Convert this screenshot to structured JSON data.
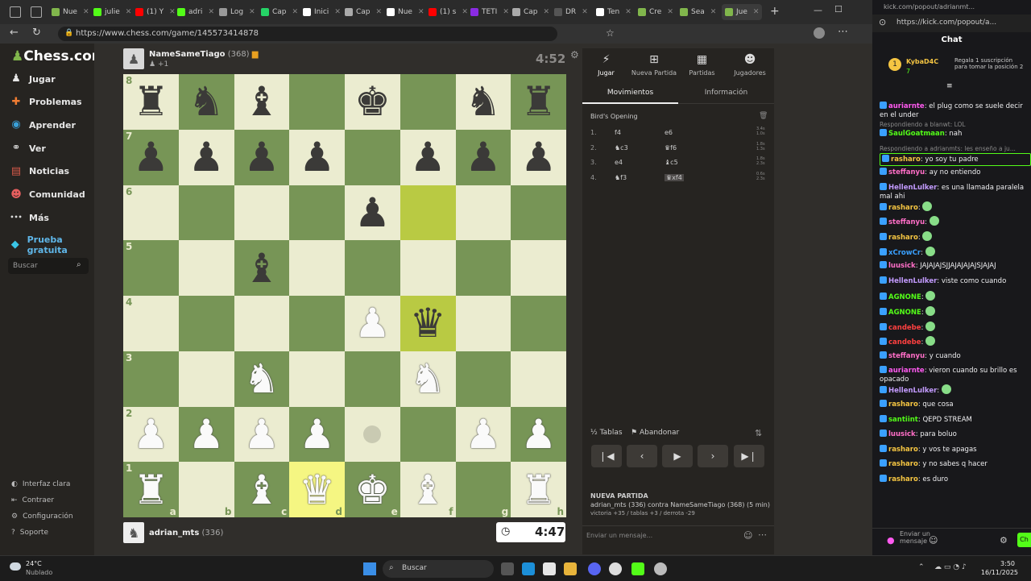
{
  "browser": {
    "tabs": [
      {
        "label": "Nue",
        "color": "#81b64c"
      },
      {
        "label": "julie",
        "color": "#53fc18"
      },
      {
        "label": "(1) Y",
        "color": "#ff0000"
      },
      {
        "label": "adri",
        "color": "#53fc18"
      },
      {
        "label": "Log",
        "color": "#999999"
      },
      {
        "label": "Cap",
        "color": "#25d366"
      },
      {
        "label": "Inici",
        "color": "#ffffff"
      },
      {
        "label": "Cap",
        "color": "#aaaaaa"
      },
      {
        "label": "Nue",
        "color": "#ffffff"
      },
      {
        "label": "(1) s",
        "color": "#ff0000"
      },
      {
        "label": "TETI",
        "color": "#8a2be2"
      },
      {
        "label": "Cap",
        "color": "#aaaaaa"
      },
      {
        "label": "DR",
        "color": "#555555"
      },
      {
        "label": "Ten",
        "color": "#ffffff"
      },
      {
        "label": "Cre",
        "color": "#81b64c"
      },
      {
        "label": "Sea",
        "color": "#81b64c"
      },
      {
        "label": "Jue",
        "color": "#81b64c"
      }
    ],
    "url": "https://www.chess.com/game/145573414878"
  },
  "sidebar": {
    "logo": "Chess.com",
    "items": [
      {
        "label": "Jugar",
        "icon": "pawn-icon"
      },
      {
        "label": "Problemas",
        "icon": "puzzle-icon"
      },
      {
        "label": "Aprender",
        "icon": "learn-icon"
      },
      {
        "label": "Ver",
        "icon": "binoculars-icon"
      },
      {
        "label": "Noticias",
        "icon": "news-icon"
      },
      {
        "label": "Comunidad",
        "icon": "community-icon"
      },
      {
        "label": "Más",
        "icon": "more-icon"
      },
      {
        "label": "Prueba gratuita",
        "icon": "diamond-icon"
      }
    ],
    "search_placeholder": "Buscar",
    "bottom": [
      "Interfaz clara",
      "Contraer",
      "Configuración",
      "Soporte"
    ]
  },
  "game": {
    "top_player": {
      "name": "NameSameTiago",
      "rating": "(368)",
      "sub": "+1",
      "clock": "4:52"
    },
    "bottom_player": {
      "name": "adrian_mts",
      "rating": "(336)",
      "clock": "4:47"
    },
    "files": [
      "a",
      "b",
      "c",
      "d",
      "e",
      "f",
      "g",
      "h"
    ],
    "ranks": [
      "8",
      "7",
      "6",
      "5",
      "4",
      "3",
      "2",
      "1"
    ],
    "board": [
      [
        "br",
        "bn",
        "bb",
        "",
        "bk",
        "",
        "bn",
        "br"
      ],
      [
        "bp",
        "bp",
        "bp",
        "bp",
        "",
        "bp",
        "bp",
        "bp"
      ],
      [
        "",
        "",
        "",
        "",
        "bp",
        "",
        "",
        ""
      ],
      [
        "",
        "",
        "bb",
        "",
        "",
        "",
        "",
        ""
      ],
      [
        "",
        "",
        "",
        "",
        "wp",
        "bq",
        "",
        ""
      ],
      [
        "",
        "",
        "wn",
        "",
        "",
        "wn",
        "",
        ""
      ],
      [
        "wp",
        "wp",
        "wp",
        "wp",
        "",
        "",
        "wp",
        "wp"
      ],
      [
        "wr",
        "",
        "wb",
        "wq",
        "wk",
        "wb",
        "",
        "wr"
      ]
    ]
  },
  "panel": {
    "tabs": [
      {
        "label": "Jugar",
        "icon": "lightning-icon"
      },
      {
        "label": "Nueva Partida",
        "icon": "plus-icon"
      },
      {
        "label": "Partidas",
        "icon": "grid-icon"
      },
      {
        "label": "Jugadores",
        "icon": "players-icon"
      }
    ],
    "subtabs": [
      "Movimientos",
      "Información"
    ],
    "opening": "Bird's Opening",
    "moves": [
      {
        "n": "1.",
        "w": "f4",
        "b": "e6",
        "t": [
          "3.4s",
          "1.0s"
        ]
      },
      {
        "n": "2.",
        "w": "♞c3",
        "b": "♛f6",
        "t": [
          "1.8s",
          "1.3s"
        ]
      },
      {
        "n": "3.",
        "w": "e4",
        "b": "♝c5",
        "t": [
          "1.8s",
          "2.3s"
        ]
      },
      {
        "n": "4.",
        "w": "♞f3",
        "b": "♛xf4",
        "t": [
          "0.6s",
          "2.3s"
        ]
      }
    ],
    "controls": [
      "⏮",
      "◀",
      "▶",
      "▶",
      "⏭"
    ],
    "draw": "Tablas",
    "resign": "Abandonar",
    "new_game_title": "NUEVA PARTIDA",
    "new_game_line": "adrian_mts (336) contra NameSameTiago (368) (5 min)",
    "new_game_stats": "victoria +35 / tablas +3 / derrota -29",
    "message_placeholder": "Enviar un mensaje..."
  },
  "chat": {
    "url": "https://kick.com/popout/a...",
    "popup_url": "kick.com/popout/adrianmt...",
    "title": "Chat",
    "sub_user": "KybaD4C",
    "sub_count": "7",
    "sub_text": "Regala 1 suscripción para tomar la posición 2",
    "messages": [
      {
        "user": "auriarnte",
        "text": "el plug como se suele decir en el under",
        "color": "#ff5af0"
      },
      {
        "user": "SaulGoatmaan",
        "text": "nah",
        "color": "#53fc18",
        "reply": "Respondiendo a blanwt: LOL"
      },
      {
        "user": "rasharo",
        "text": "yo soy tu padre",
        "color": "#f5c542",
        "reply": "Respondiendo a adrianmts: les enseño a ju..."
      },
      {
        "user": "steffanyu",
        "text": "ay no entiendo",
        "color": "#ff6ec7"
      },
      {
        "user": "HellenLulker",
        "text": "es una llamada paralela mal ahi",
        "color": "#c39bff"
      },
      {
        "user": "rasharo",
        "text": "",
        "color": "#f5c542"
      },
      {
        "user": "steffanyu",
        "text": "",
        "color": "#ff6ec7"
      },
      {
        "user": "rasharo",
        "text": "",
        "color": "#f5c542"
      },
      {
        "user": "xCrowCr",
        "text": "",
        "color": "#3aa0ff"
      },
      {
        "user": "luusick",
        "text": "JAJAJAJSJJAJAJAJAJSJAJAJ",
        "color": "#ff6ec7"
      },
      {
        "user": "HellenLulker",
        "text": "viste como cuando",
        "color": "#c39bff"
      },
      {
        "user": "AGNONE",
        "text": "",
        "color": "#53fc18"
      },
      {
        "user": "AGNONE",
        "text": "",
        "color": "#53fc18"
      },
      {
        "user": "candebe",
        "text": "",
        "color": "#ff4040"
      },
      {
        "user": "candebe",
        "text": "",
        "color": "#ff4040"
      },
      {
        "user": "steffanyu",
        "text": "y cuando",
        "color": "#ff6ec7"
      },
      {
        "user": "auriarnte",
        "text": "vieron cuando su brillo es opacado",
        "color": "#ff5af0"
      },
      {
        "user": "HellenLulker",
        "text": "",
        "color": "#c39bff"
      },
      {
        "user": "rasharo",
        "text": "que cosa",
        "color": "#f5c542"
      },
      {
        "user": "santiint",
        "text": "QEPD STREAM",
        "color": "#53fc18"
      },
      {
        "user": "luusick",
        "text": "para boluo",
        "color": "#ff6ec7"
      },
      {
        "user": "rasharo",
        "text": "y vos te apagas",
        "color": "#f5c542"
      },
      {
        "user": "rasharo",
        "text": "y no sabes q hacer",
        "color": "#f5c542"
      },
      {
        "user": "rasharo",
        "text": "es duro",
        "color": "#f5c542"
      }
    ],
    "send_placeholder": "Enviar un mensaje",
    "send_button": "Ch"
  },
  "taskbar": {
    "weather_temp": "24°C",
    "weather_desc": "Nublado",
    "search": "Buscar",
    "time": "3:50",
    "date": "16/11/2025"
  }
}
